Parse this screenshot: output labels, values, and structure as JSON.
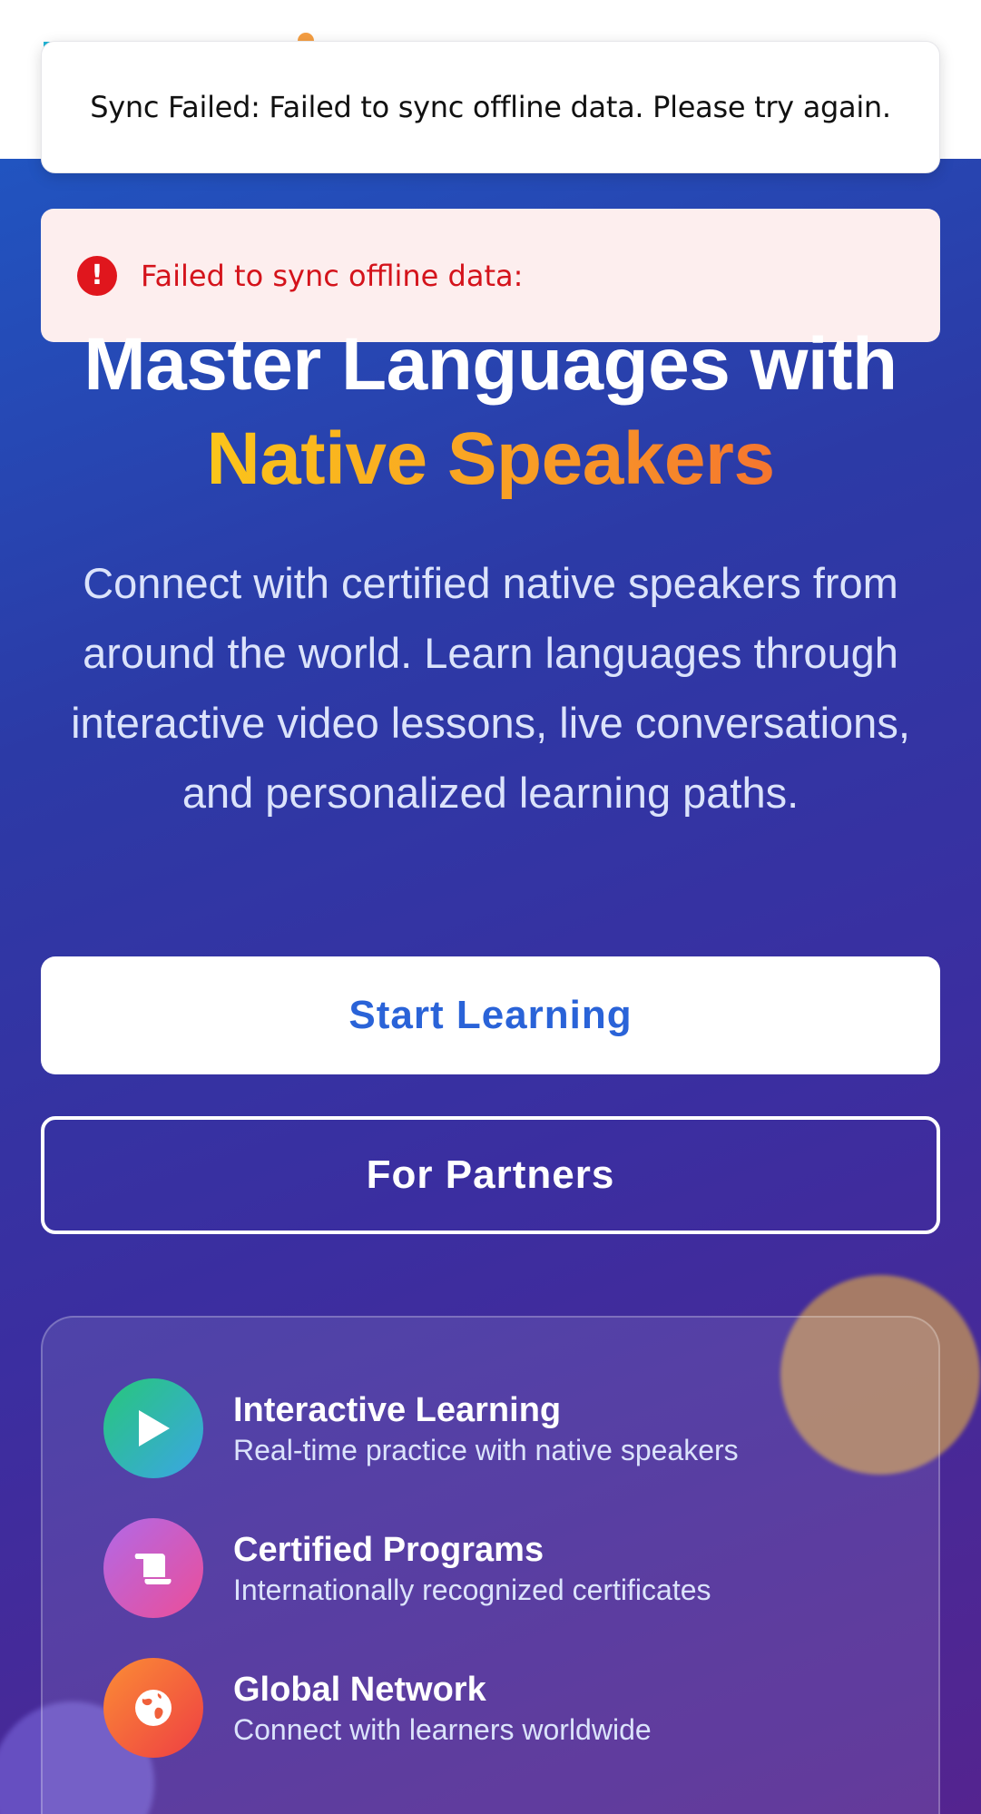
{
  "toast": {
    "message": "Sync Failed: Failed to sync offline data. Please try again."
  },
  "alert": {
    "icon": "!",
    "message": "Failed to sync offline data:"
  },
  "hero": {
    "title_line1": "Master Languages with",
    "title_line2": "Native Speakers",
    "subtitle": "Connect with certified native speakers from around the world. Learn languages through interactive video lessons, live conversations, and personalized learning paths.",
    "primary_cta": "Start Learning",
    "secondary_cta": "For Partners"
  },
  "features": [
    {
      "icon": "play-icon",
      "title": "Interactive Learning",
      "desc": "Real-time practice with native speakers"
    },
    {
      "icon": "certificate-icon",
      "title": "Certified Programs",
      "desc": "Internationally recognized certificates"
    },
    {
      "icon": "globe-icon",
      "title": "Global Network",
      "desc": "Connect with learners worldwide"
    }
  ],
  "colors": {
    "primary_blue": "#2a63d8",
    "error_red": "#d4131b",
    "accent_yellow": "#fbc51a",
    "accent_orange": "#f5752f"
  }
}
